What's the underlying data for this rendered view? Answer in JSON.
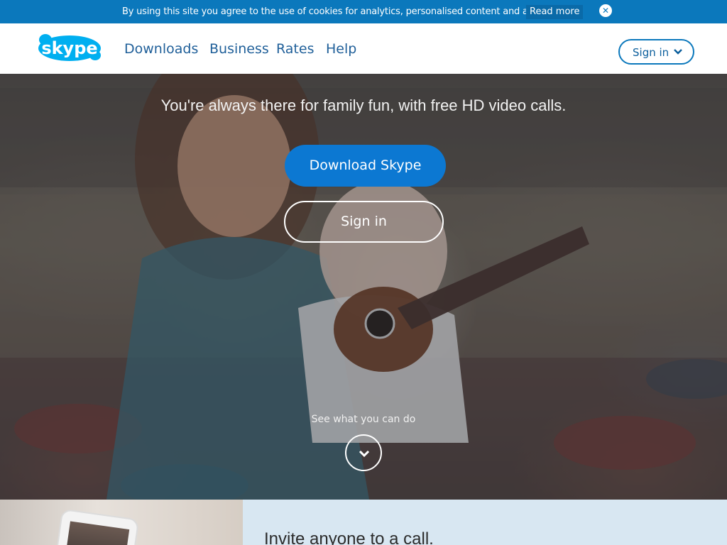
{
  "cookie_bar": {
    "text": "By using this site you agree to the use of cookies for analytics, personalised content and ads.",
    "link": "Read more",
    "close_icon": "close-icon"
  },
  "nav": {
    "logo_text": "skype",
    "links": [
      "Downloads",
      "Business",
      "Rates",
      "Help"
    ],
    "signin": "Sign in"
  },
  "hero": {
    "subtitle": "You're always there for family fun, with free HD video calls.",
    "download_button": "Download Skype",
    "signin_button": "Sign in",
    "see_what": "See what you can do"
  },
  "lower": {
    "title": "Invite anyone to a call."
  },
  "colors": {
    "brand_blue": "#0b78bc",
    "download_button": "#0c78d2",
    "lower_bg": "#d8e7f2"
  }
}
